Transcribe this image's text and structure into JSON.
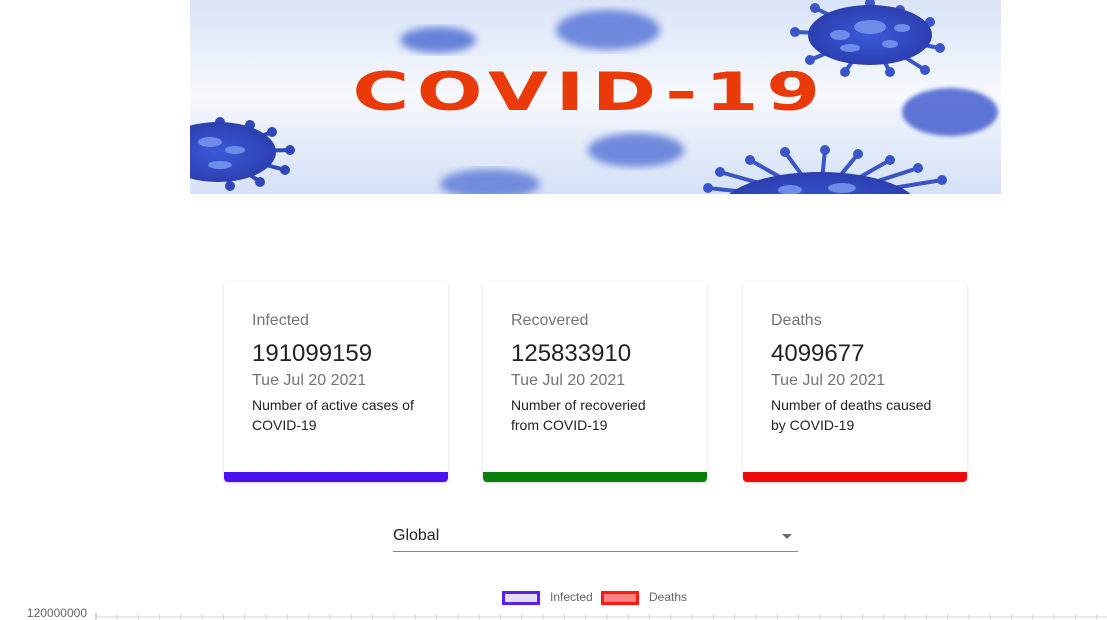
{
  "banner": {
    "title": "COVID-19"
  },
  "cards": [
    {
      "id": "infected",
      "label": "Infected",
      "value": "191099159",
      "date": "Tue Jul 20 2021",
      "description": "Number of active cases of COVID-19",
      "color": "#4b0ff0"
    },
    {
      "id": "recovered",
      "label": "Recovered",
      "value": "125833910",
      "date": "Tue Jul 20 2021",
      "description": "Number of recoveried from COVID-19",
      "color": "#0a800a"
    },
    {
      "id": "deaths",
      "label": "Deaths",
      "value": "4099677",
      "date": "Tue Jul 20 2021",
      "description": "Number of deaths caused by COVID-19",
      "color": "#f00a0a"
    }
  ],
  "country_select": {
    "selected": "Global",
    "icon": "chevron-down-icon"
  },
  "chart": {
    "legend": [
      {
        "label": "Infected",
        "stroke": "#5b1ff0",
        "fill": "#e3ddf5"
      },
      {
        "label": "Deaths",
        "stroke": "#ff1a1a",
        "fill": "#ff8080"
      }
    ],
    "y_ticks": [
      "120000000"
    ]
  },
  "chart_data": {
    "type": "line",
    "series": [
      {
        "name": "Infected",
        "values": []
      },
      {
        "name": "Deaths",
        "values": []
      }
    ],
    "yticks": [
      120000000
    ],
    "grid": true,
    "legend": "top"
  }
}
